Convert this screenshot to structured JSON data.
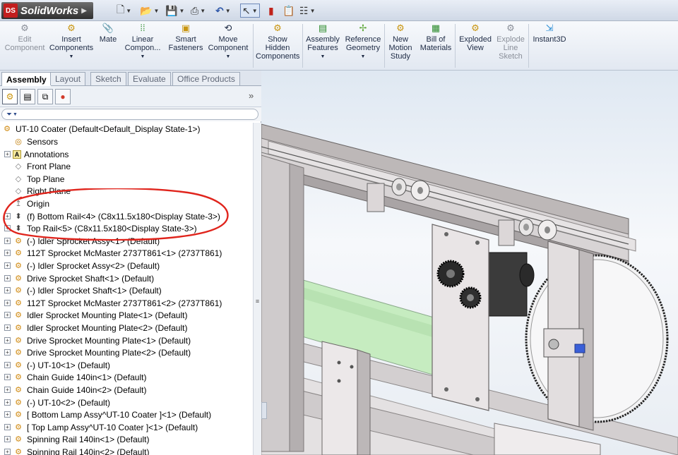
{
  "app": {
    "name": "SolidWorks",
    "logo_mark": "DS"
  },
  "quick_access": {
    "icons": [
      "new-document-icon",
      "open-icon",
      "save-icon",
      "print-icon",
      "undo-icon",
      "select-icon",
      "rebuild-icon",
      "file-properties-icon",
      "options-icon"
    ]
  },
  "ribbon": {
    "buttons": [
      {
        "label": "Edit Component",
        "icon": "edit-component-icon",
        "enabled": false,
        "dropdown": false
      },
      {
        "label": "Insert Components",
        "icon": "insert-components-icon",
        "enabled": true,
        "dropdown": true
      },
      {
        "label": "Mate",
        "icon": "mate-icon",
        "enabled": true,
        "dropdown": false
      },
      {
        "label": "Linear Compon...",
        "icon": "linear-pattern-icon",
        "enabled": true,
        "dropdown": true
      },
      {
        "label": "Smart Fasteners",
        "icon": "smart-fasteners-icon",
        "enabled": true,
        "dropdown": false
      },
      {
        "label": "Move Component",
        "icon": "move-component-icon",
        "enabled": true,
        "dropdown": true
      },
      {
        "label": "Show Hidden Components",
        "icon": "show-hidden-icon",
        "enabled": true,
        "dropdown": false
      },
      {
        "label": "Assembly Features",
        "icon": "assembly-features-icon",
        "enabled": true,
        "dropdown": true
      },
      {
        "label": "Reference Geometry",
        "icon": "reference-geometry-icon",
        "enabled": true,
        "dropdown": true
      },
      {
        "label": "New Motion Study",
        "icon": "motion-study-icon",
        "enabled": true,
        "dropdown": false
      },
      {
        "label": "Bill of Materials",
        "icon": "bill-of-materials-icon",
        "enabled": true,
        "dropdown": false
      },
      {
        "label": "Exploded View",
        "icon": "exploded-view-icon",
        "enabled": true,
        "dropdown": false
      },
      {
        "label": "Explode Line Sketch",
        "icon": "explode-line-sketch-icon",
        "enabled": false,
        "dropdown": false
      },
      {
        "label": "Instant3D",
        "icon": "instant3d-icon",
        "enabled": true,
        "dropdown": false
      }
    ]
  },
  "tabs": [
    {
      "label": "Assembly",
      "active": true
    },
    {
      "label": "Layout",
      "active": false
    },
    {
      "label": "Sketch",
      "active": false
    },
    {
      "label": "Evaluate",
      "active": false
    },
    {
      "label": "Office Products",
      "active": false
    }
  ],
  "panel": {
    "tab_icons": [
      "feature-manager-icon",
      "property-manager-icon",
      "configuration-manager-icon",
      "display-manager-icon"
    ],
    "expand_glyph": "»",
    "filter_glyph": "▼"
  },
  "tree": {
    "root": "UT-10 Coater  (Default<Default_Display State-1>)",
    "items": [
      {
        "label": "Sensors",
        "icon": "sensors-icon",
        "expandable": false
      },
      {
        "label": "Annotations",
        "icon": "annotations-icon",
        "expandable": true
      },
      {
        "label": "Front Plane",
        "icon": "plane-icon",
        "expandable": false
      },
      {
        "label": "Top Plane",
        "icon": "plane-icon",
        "expandable": false
      },
      {
        "label": "Right Plane",
        "icon": "plane-icon",
        "expandable": false
      },
      {
        "label": "Origin",
        "icon": "origin-icon",
        "expandable": false
      },
      {
        "label": "(f) Bottom Rail<4> (C8x11.5x180<Display State-3>)",
        "icon": "part-icon",
        "expandable": true
      },
      {
        "label": "Top Rail<5> (C8x11.5x180<Display State-3>)",
        "icon": "part-icon",
        "expandable": true
      },
      {
        "label": "(-) Idler Sprocket Assy<1> (Default)",
        "icon": "subassembly-icon",
        "expandable": true
      },
      {
        "label": "112T Sprocket McMaster 2737T861<1> (2737T861)",
        "icon": "subassembly-icon",
        "expandable": true
      },
      {
        "label": "(-) Idler Sprocket Assy<2> (Default)",
        "icon": "subassembly-icon",
        "expandable": true
      },
      {
        "label": "Drive Sprocket Shaft<1> (Default)",
        "icon": "subassembly-icon",
        "expandable": true
      },
      {
        "label": "(-) Idler Sprocket Shaft<1> (Default)",
        "icon": "subassembly-icon",
        "expandable": true
      },
      {
        "label": "112T Sprocket McMaster 2737T861<2> (2737T861)",
        "icon": "subassembly-icon",
        "expandable": true
      },
      {
        "label": "Idler Sprocket Mounting Plate<1> (Default)",
        "icon": "subassembly-icon",
        "expandable": true
      },
      {
        "label": "Idler Sprocket Mounting Plate<2> (Default)",
        "icon": "subassembly-icon",
        "expandable": true
      },
      {
        "label": "Drive Sprocket Mounting Plate<1> (Default)",
        "icon": "subassembly-icon",
        "expandable": true
      },
      {
        "label": "Drive Sprocket Mounting Plate<2> (Default)",
        "icon": "subassembly-icon",
        "expandable": true
      },
      {
        "label": "(-) UT-10<1> (Default)",
        "icon": "subassembly-icon",
        "expandable": true
      },
      {
        "label": "Chain Guide 140in<1> (Default)",
        "icon": "subassembly-icon",
        "expandable": true
      },
      {
        "label": "Chain Guide 140in<2> (Default)",
        "icon": "subassembly-icon",
        "expandable": true
      },
      {
        "label": "(-) UT-10<2> (Default)",
        "icon": "subassembly-icon",
        "expandable": true
      },
      {
        "label": "[ Bottom Lamp Assy^UT-10 Coater ]<1> (Default)",
        "icon": "subassembly-icon",
        "expandable": true
      },
      {
        "label": "[ Top Lamp Assy^UT-10 Coater ]<1> (Default)",
        "icon": "subassembly-icon",
        "expandable": true
      },
      {
        "label": "Spinning Rail 140in<1> (Default)",
        "icon": "subassembly-icon",
        "expandable": true
      },
      {
        "label": "Spinning Rail 140in<2> (Default)",
        "icon": "subassembly-icon",
        "expandable": true
      }
    ]
  },
  "colors": {
    "annotation_circle": "#e0241c",
    "frame_steel": "#c9c4c4",
    "plate": "#dcd6d8",
    "lamp_green": "#c9eec4",
    "viewport_top": "#dfe8f2"
  }
}
